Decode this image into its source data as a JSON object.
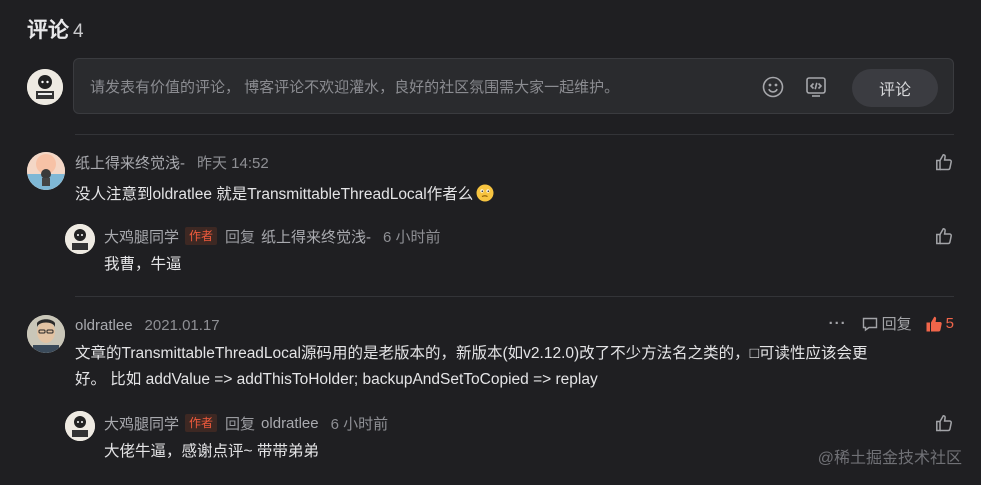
{
  "header": {
    "title": "评论",
    "count": "4"
  },
  "composer": {
    "placeholder": "请发表有价值的评论， 博客评论不欢迎灌水，良好的社区氛围需大家一起维护。",
    "submit_label": "评论",
    "emoji_icon": "smile-icon",
    "code_icon": "code-icon"
  },
  "comments": [
    {
      "author": "纸上得来终觉浅-",
      "time": "昨天 14:52",
      "text": "没人注意到oldratlee 就是TransmittableThreadLocal作者么",
      "replies": [
        {
          "author": "大鸡腿同学",
          "badge": "作者",
          "reply_word": "回复",
          "reply_to": "纸上得来终觉浅-",
          "time": "6 小时前",
          "text": "我曹，牛逼"
        }
      ]
    },
    {
      "author": "oldratlee",
      "time": "2021.01.17",
      "more": "···",
      "reply_label": "回复",
      "likes": "5",
      "text_line1": "文章的TransmittableThreadLocal源码用的是老版本的，新版本(如v2.12.0)改了不少方法名之类的，□可读性应该会更",
      "text_line2": "好。 比如 addValue => addThisToHolder; backupAndSetToCopied => replay",
      "replies": [
        {
          "author": "大鸡腿同学",
          "badge": "作者",
          "reply_word": "回复",
          "reply_to": "oldratlee",
          "time": "6 小时前",
          "text": "大佬牛逼，感谢点评~ 带带弟弟"
        }
      ]
    }
  ],
  "watermark": "@稀土掘金技术社区",
  "colors": {
    "background": "#1f1f22",
    "accent_like": "#f0654a",
    "author_badge": "#f05a3c"
  }
}
